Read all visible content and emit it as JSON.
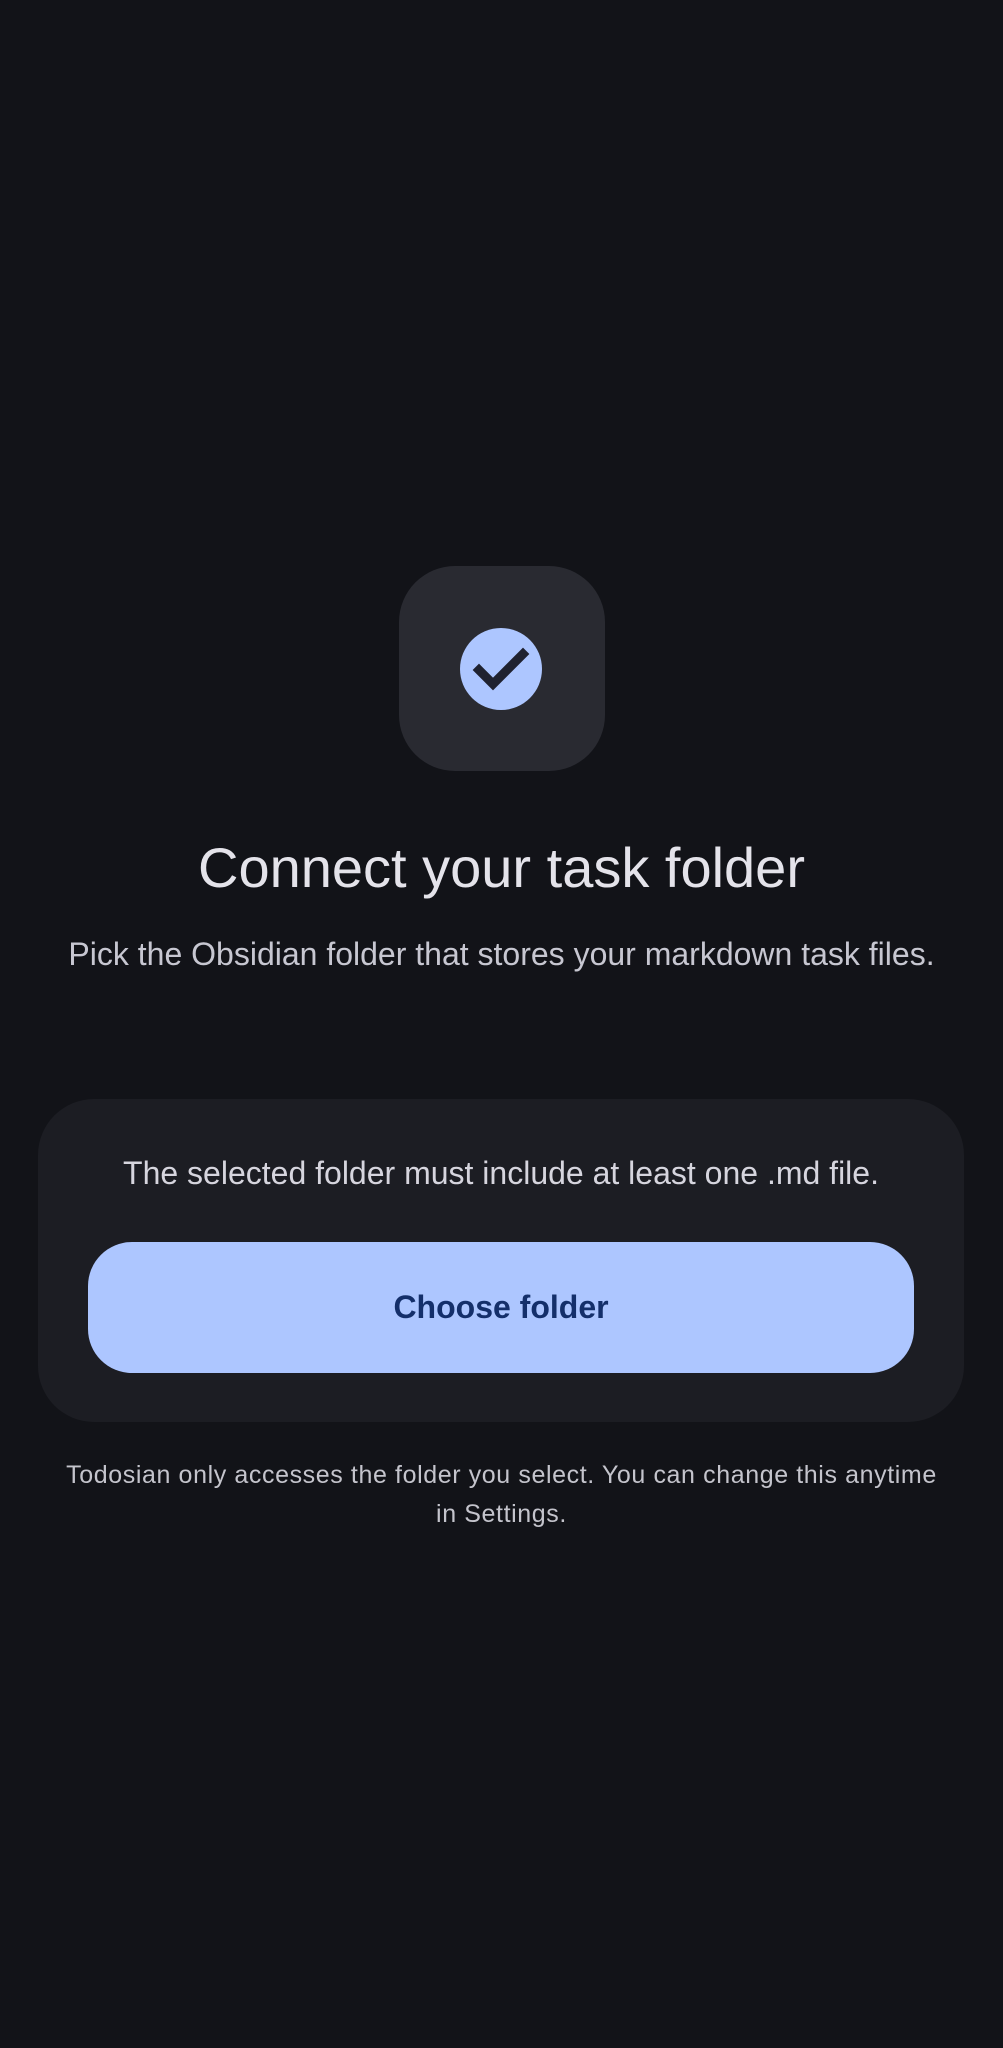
{
  "onboarding": {
    "icon": "check-circle-icon",
    "title": "Connect your task folder",
    "subtitle": "Pick the Obsidian folder that stores your markdown task files.",
    "requirement": "The selected folder must include at least one .md file.",
    "choose_button_label": "Choose folder",
    "privacy_note": "Todosian only accesses the folder you select. You can change this anytime in Settings."
  },
  "colors": {
    "background": "#121318",
    "icon_tile": "#292a31",
    "accent": "#adc6ff",
    "on_accent": "#142f6a",
    "card": "#1c1d23"
  }
}
